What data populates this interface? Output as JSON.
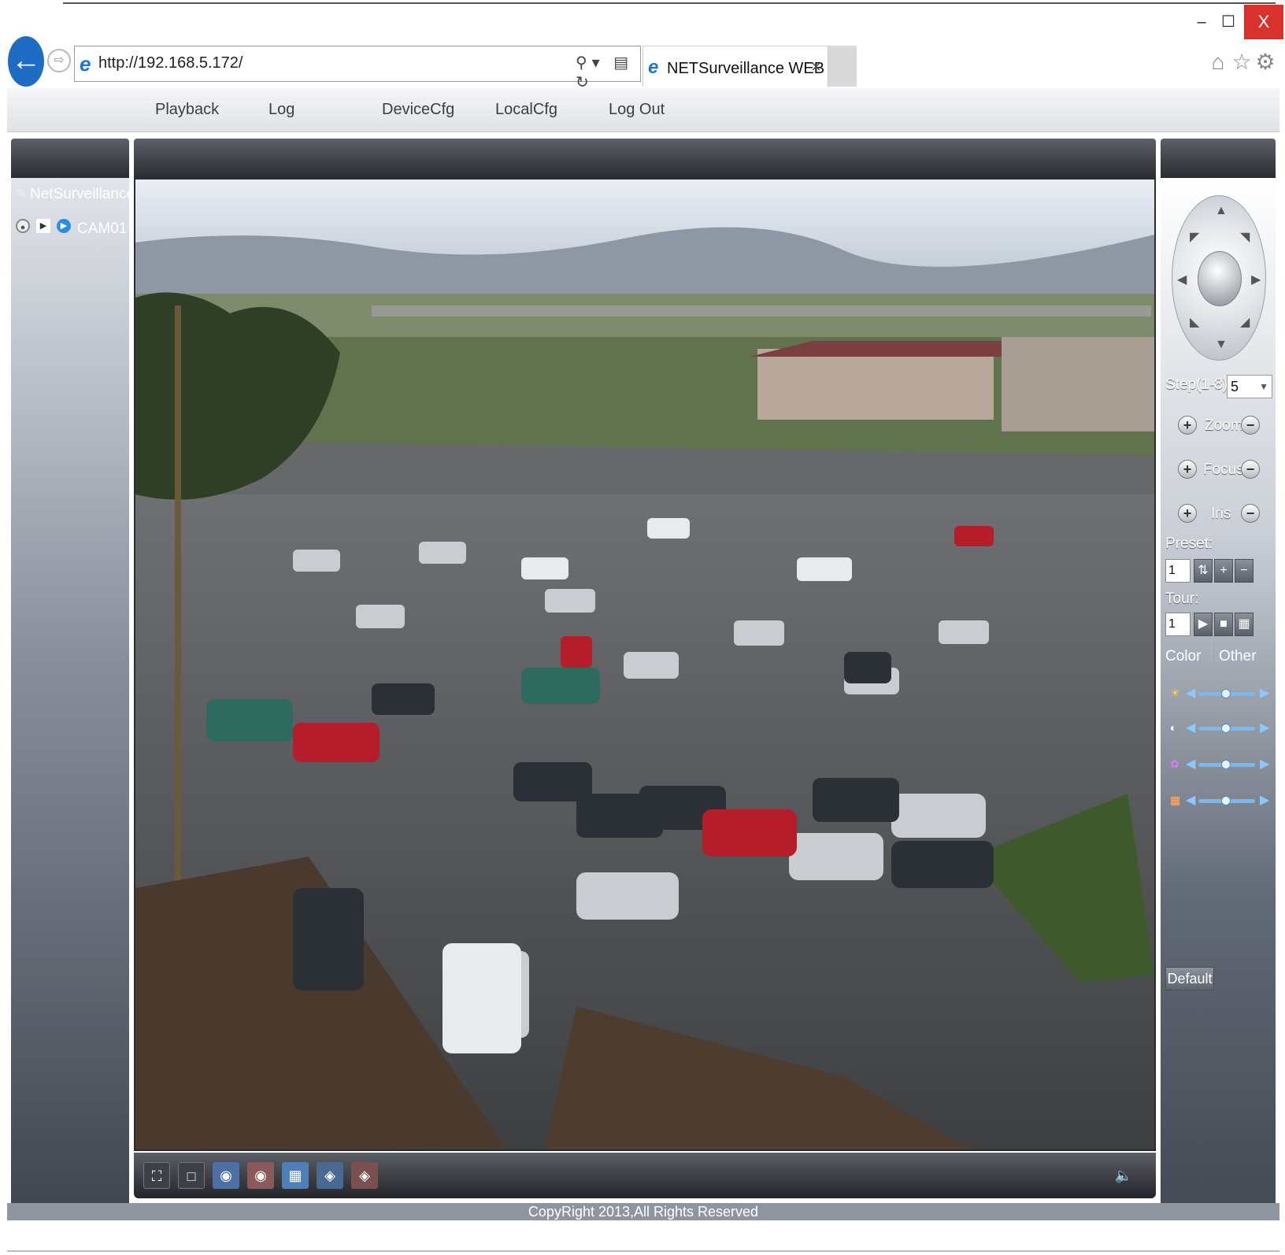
{
  "browser": {
    "url": "http://192.168.5.172/",
    "tab_title": "NETSurveillance WEB",
    "tab_close": "×",
    "window_close": "X",
    "window_minimize": "–",
    "window_maximize": "☐"
  },
  "nav": {
    "items": [
      "Playback",
      "Log",
      "DeviceCfg",
      "LocalCfg",
      "Log Out"
    ]
  },
  "device_tree": {
    "root": "NetSurveillance",
    "camera": "CAM01"
  },
  "ptz": {
    "step_label": "Step(1-8):",
    "step_value": "5",
    "zoom_label": "Zoom",
    "focus_label": "Focus",
    "iris_label": "Iris",
    "preset_label": "Preset:",
    "preset_value": "1",
    "tour_label": "Tour:",
    "tour_value": "1"
  },
  "image_tabs": {
    "color": "Color",
    "other": "Other"
  },
  "sliders": [
    {
      "name": "brightness",
      "icon": "sun-icon",
      "value": 0.5
    },
    {
      "name": "contrast",
      "icon": "contrast-icon",
      "value": 0.5
    },
    {
      "name": "saturation",
      "icon": "color-wheel-icon",
      "value": 0.5
    },
    {
      "name": "hue",
      "icon": "palette-icon",
      "value": 0.5
    }
  ],
  "default_button": "Default",
  "footer": "CopyRight 2013,All Rights Reserved",
  "colors": {
    "accent_blue": "#1f6cc4",
    "close_red": "#d9322c",
    "panel_dark": "#2a2c31"
  }
}
